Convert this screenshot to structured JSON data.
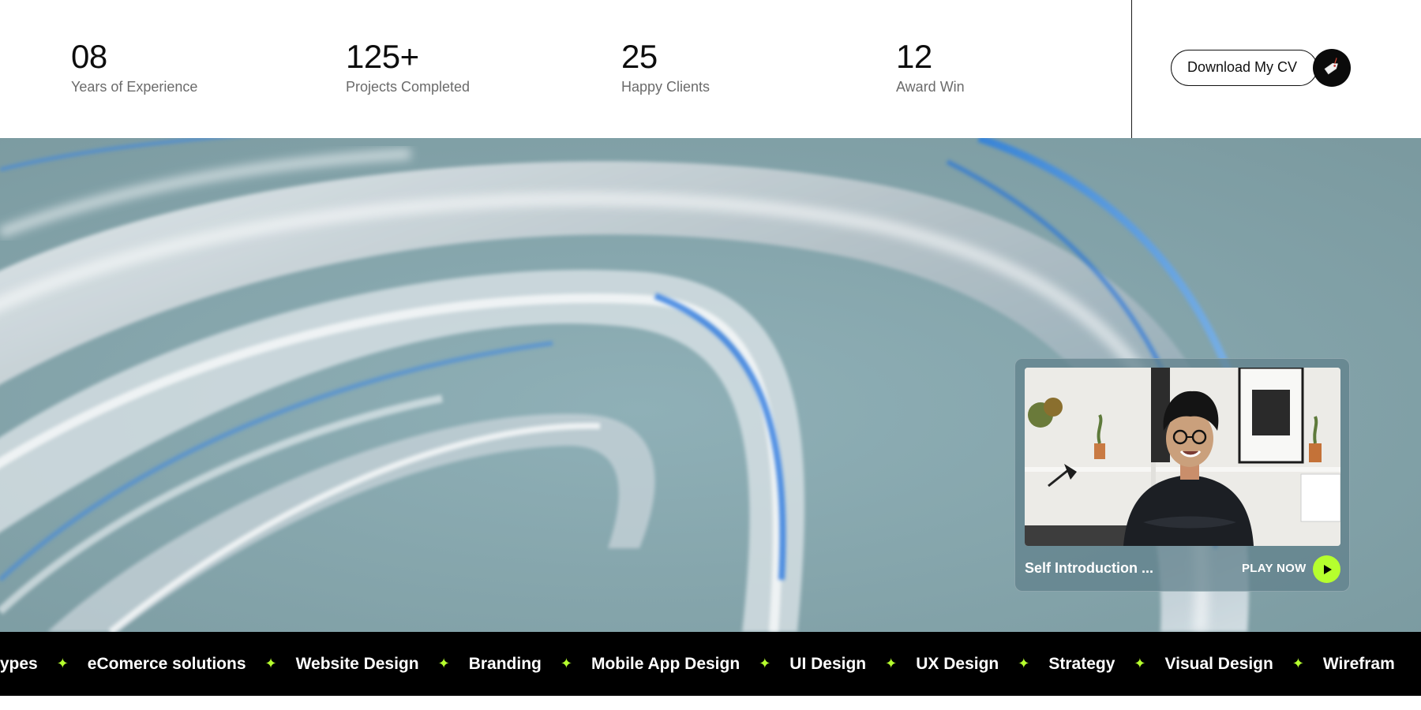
{
  "stats": [
    {
      "value": "08",
      "label": "Years of Experience"
    },
    {
      "value": "125+",
      "label": "Projects Completed"
    },
    {
      "value": "25",
      "label": "Happy Clients"
    },
    {
      "value": "12",
      "label": "Award Win"
    }
  ],
  "cv": {
    "label": "Download My CV",
    "icon": "download-tag-icon"
  },
  "video": {
    "title": "Self Introduction ...",
    "play_label": "PLAY NOW",
    "icon": "play-icon"
  },
  "marquee": {
    "items": [
      "rototypes",
      "eComerce solutions",
      "Website Design",
      "Branding",
      "Mobile App Design",
      "UI Design",
      "UX Design",
      "Strategy",
      "Visual Design",
      "Wirefram"
    ],
    "separator": "✦"
  },
  "colors": {
    "accent": "#b6ff2e",
    "dark": "#000000",
    "hero_bg": "#7e9ea4"
  }
}
